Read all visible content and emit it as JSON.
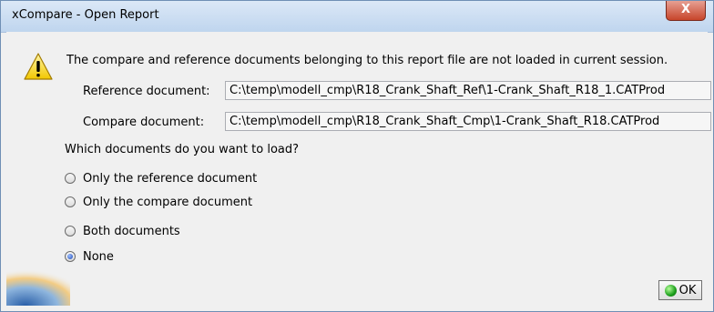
{
  "window": {
    "title": "xCompare - Open Report",
    "close_glyph": "X"
  },
  "message": "The compare and reference documents belonging to this report file are not loaded in current session.",
  "reference": {
    "label": "Reference document:",
    "value": "C:\\temp\\modell_cmp\\R18_Crank_Shaft_Ref\\1-Crank_Shaft_R18_1.CATProd"
  },
  "compare": {
    "label": "Compare document:",
    "value": "C:\\temp\\modell_cmp\\R18_Crank_Shaft_Cmp\\1-Crank_Shaft_R18.CATProd"
  },
  "question": "Which documents do you want to load?",
  "options": [
    {
      "label": "Only the reference document",
      "selected": false
    },
    {
      "label": "Only the compare document",
      "selected": false
    },
    {
      "label": "Both documents",
      "selected": false
    },
    {
      "label": "None",
      "selected": true
    }
  ],
  "ok_label": "OK",
  "icons": {
    "warning": "warning-icon",
    "ok": "ok-status-icon"
  }
}
